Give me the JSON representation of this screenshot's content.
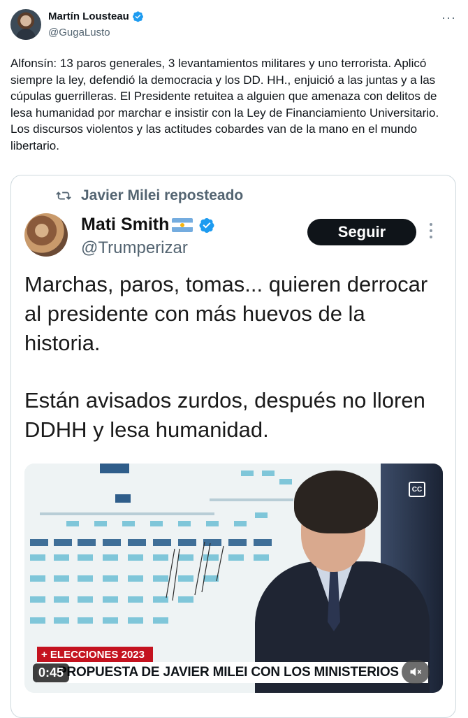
{
  "tweet": {
    "author_name": "Martín Lousteau",
    "author_handle": "@GugaLusto",
    "more_icon": "more-horizontal-icon",
    "text": "Alfonsín: 13 paros generales, 3 levantamientos militares y uno terrorista. Aplicó siempre la ley, defendió la democracia y los DD. HH., enjuició a las juntas y a las cúpulas guerrilleras. El Presidente retuitea a alguien que amenaza con delitos de lesa humanidad por marchar e insistir con la Ley de Financiamiento Universitario. Los discursos violentos y las actitudes cobardes van de la mano en el mundo libertario."
  },
  "quoted": {
    "repost_label": "Javier Milei reposteado",
    "author_name": "Mati Smith",
    "author_handle": "@Trumperizar",
    "follow_label": "Seguir",
    "text_1": "Marchas, paros, tomas... quieren derrocar al presidente con más huevos de la historia.",
    "text_2": "Están avisados zurdos, después no lloren DDHH y lesa humanidad.",
    "video": {
      "banner_top": "+ ELECCIONES 2023",
      "banner_bottom": "PROPUESTA DE JAVIER MILEI CON LOS MINISTERIOS",
      "time": "0:45",
      "cc_label": "CC"
    }
  },
  "colors": {
    "verified_blue": "#1d9bf0",
    "text_secondary": "#536471",
    "news_red": "#c4121f",
    "button_dark": "#0f1419"
  }
}
